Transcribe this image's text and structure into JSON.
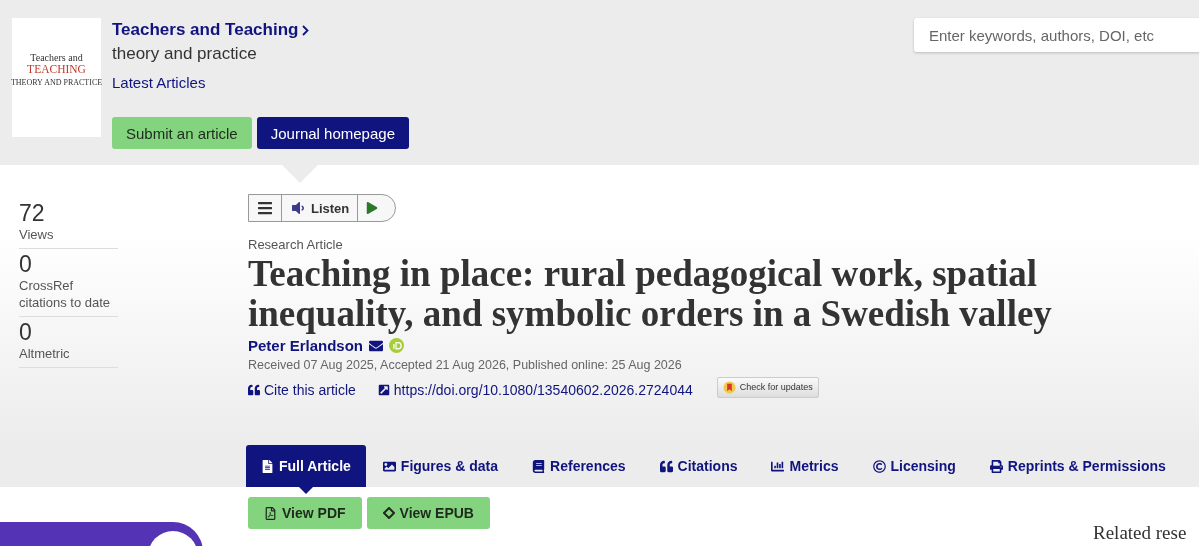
{
  "journal": {
    "cover": {
      "title_line_1": "Teachers and",
      "title_line_2": "TEACHING",
      "subtitle": "THEORY AND PRACTICE"
    },
    "title": "Teachers and Teaching",
    "subtitle": "theory and practice",
    "latest_link": "Latest Articles",
    "buttons": [
      "Submit an article",
      "Journal homepage"
    ]
  },
  "search": {
    "placeholder": "Enter keywords, authors, DOI, etc"
  },
  "metrics": [
    {
      "value": "72",
      "label": "Views"
    },
    {
      "value": "0",
      "label": "CrossRef citations to date"
    },
    {
      "value": "0",
      "label": "Altmetric"
    }
  ],
  "listen_bar": {
    "label": "Listen"
  },
  "article": {
    "type": "Research Article",
    "title": "Teaching in place: rural pedagogical work, spatial inequality, and symbolic orders in a Swedish valley",
    "author": "Peter Erlandson",
    "dates": "Received 07 Aug 2025, Accepted 21 Aug 2026, Published online: 25 Aug 2026",
    "cite_link": "Cite this article",
    "doi_link": "https://doi.org/10.1080/13540602.2026.2724044",
    "updates_badge": "Check for updates"
  },
  "tabs": [
    {
      "label": "Full Article",
      "selected": true
    },
    {
      "label": "Figures & data",
      "selected": false
    },
    {
      "label": "References",
      "selected": false
    },
    {
      "label": "Citations",
      "selected": false
    },
    {
      "label": "Metrics",
      "selected": false
    },
    {
      "label": "Licensing",
      "selected": false
    },
    {
      "label": "Reprints & Permissions",
      "selected": false
    }
  ],
  "download_buttons": [
    "View PDF",
    "View EPUB"
  ],
  "related_heading": "Related rese"
}
